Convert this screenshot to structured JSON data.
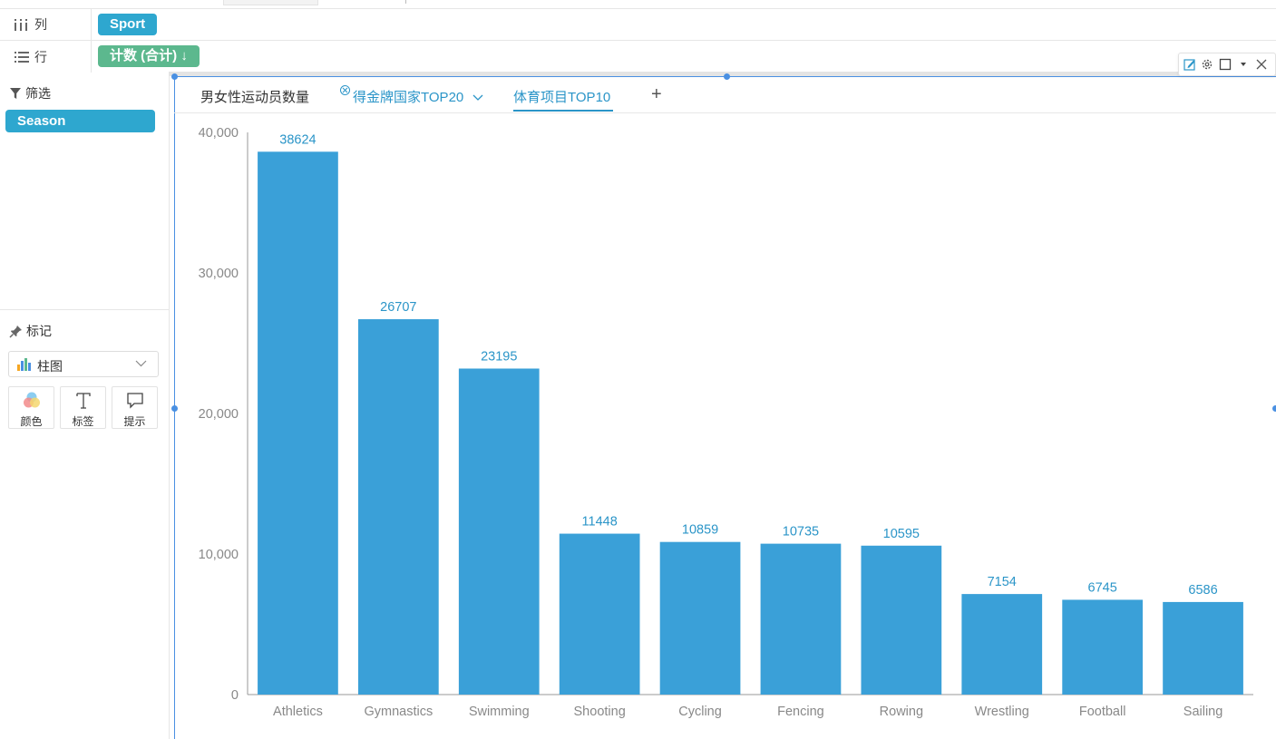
{
  "shelves": {
    "columns": {
      "label": "列",
      "pill": "Sport"
    },
    "rows": {
      "label": "行",
      "pill": "计数 (合计) ↓"
    }
  },
  "filter": {
    "title": "筛选",
    "items": [
      "Season"
    ]
  },
  "marks": {
    "title": "标记",
    "chart_type": "柱图",
    "buttons": [
      {
        "label": "颜色",
        "icon": "color-icon"
      },
      {
        "label": "标签",
        "icon": "text-label-icon"
      },
      {
        "label": "提示",
        "icon": "tooltip-icon"
      }
    ]
  },
  "tabs": [
    {
      "label": "男女性运动员数量",
      "state": "normal"
    },
    {
      "label": "得金牌国家TOP20",
      "state": "link"
    },
    {
      "label": "体育项目TOP10",
      "state": "active"
    }
  ],
  "add_tab": "+",
  "colors": {
    "bar": "#3aa0d8",
    "accent": "#2b95c8",
    "pill_column": "#2ea7cf",
    "pill_row": "#5cb88e",
    "selection": "#4a90e2"
  },
  "chart_data": {
    "type": "bar",
    "categories": [
      "Athletics",
      "Gymnastics",
      "Swimming",
      "Shooting",
      "Cycling",
      "Fencing",
      "Rowing",
      "Wrestling",
      "Football",
      "Sailing"
    ],
    "values": [
      38624,
      26707,
      23195,
      11448,
      10859,
      10735,
      10595,
      7154,
      6745,
      6586
    ],
    "data_labels": [
      "38624",
      "26707",
      "23195",
      "11448",
      "10859",
      "10735",
      "10595",
      "7154",
      "6745",
      "6586"
    ],
    "ylim": [
      0,
      40000
    ],
    "yticks": [
      0,
      10000,
      20000,
      30000,
      40000
    ],
    "ytick_labels": [
      "0",
      "10,000",
      "20,000",
      "30,000",
      "40,000"
    ],
    "grid": false
  }
}
